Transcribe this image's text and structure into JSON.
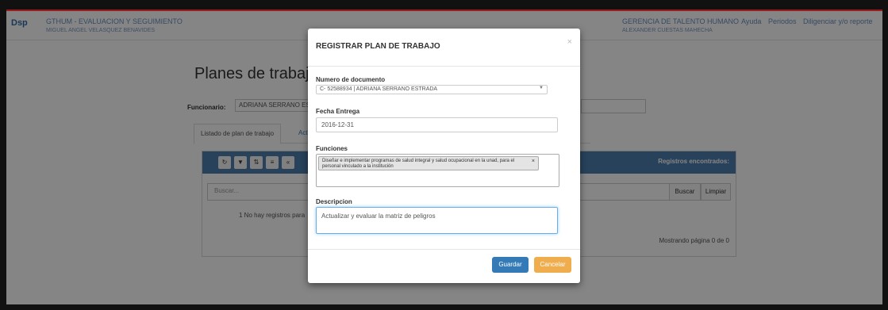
{
  "header": {
    "logo": "Dsp",
    "app_title": "GTHUM - EVALUACION Y SEGUIMIENTO",
    "user": "MIGUEL ANGEL VELASQUEZ BENAVIDES",
    "department": "GERENCIA DE TALENTO HUMANO",
    "department_user": "ALEXANDER CUESTAS MAHECHA",
    "nav": [
      "Ayuda",
      "Periodos",
      "Diligenciar y/o reporte"
    ]
  },
  "page": {
    "title": "Planes de trabajo",
    "funcionario_label": "Funcionario:",
    "funcionario_value": "ADRIANA SERRANO ESTRADA",
    "tabs": [
      "Listado de plan de trabajo",
      "Activ"
    ],
    "registros_label": "Registros encontrados:",
    "search_placeholder": "Buscar...",
    "buscar_btn": "Buscar",
    "limpiar_btn": "Limpiar",
    "no_records": "1   No hay registros para",
    "status": "Mostrando página 0 de 0"
  },
  "modal": {
    "title": "REGISTRAR PLAN DE TRABAJO",
    "close": "×",
    "doc_label": "Numero de documento",
    "doc_value": "C- 52588934 | ADRIANA SERRANO ESTRADA",
    "fecha_label": "Fecha Entrega",
    "fecha_value": "2016-12-31",
    "funciones_label": "Funciones",
    "funciones_chip": "Diseñar e implementar programas de salud integral y salud ocupacional en la unad, para el personal vinculado a la institución",
    "descripcion_label": "Descripcion",
    "descripcion_value": "Actualizar y evaluar la matriz de peligros",
    "guardar": "Guardar",
    "cancelar": "Cancelar"
  }
}
